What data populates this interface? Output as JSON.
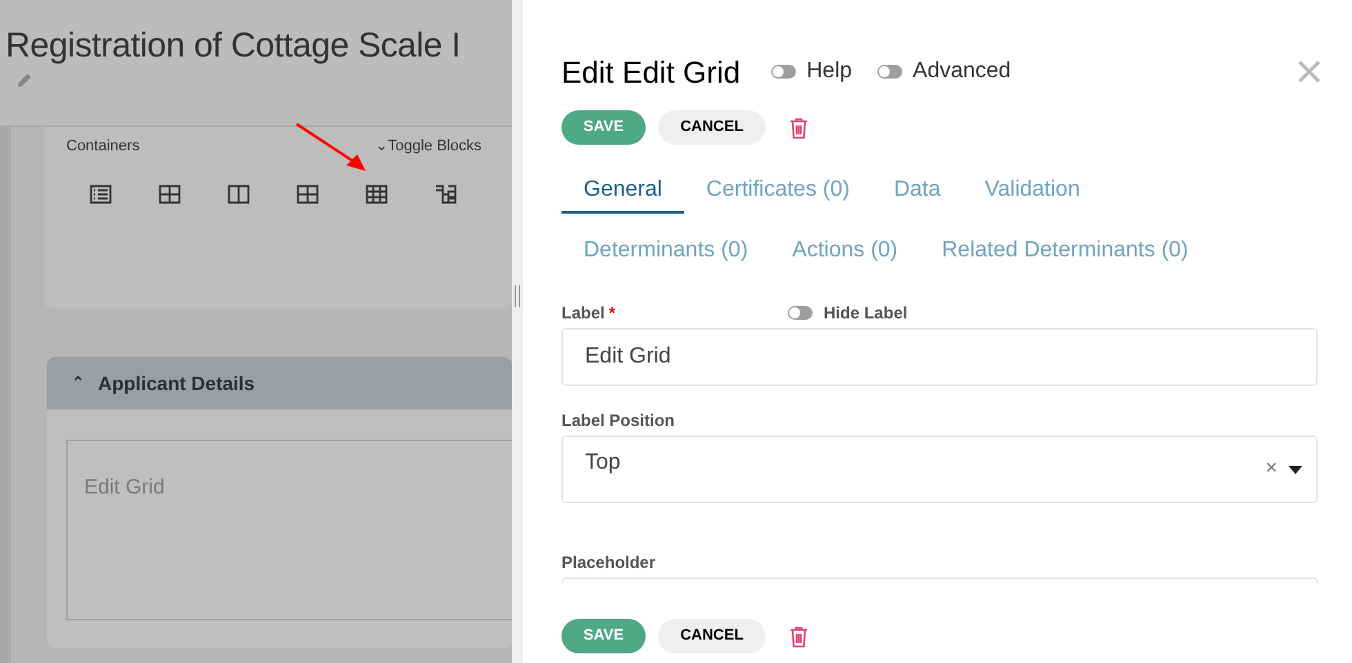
{
  "page": {
    "title": "Registration of Cottage Scale I",
    "toolbox": {
      "label": "Containers",
      "toggle_icon": "⌄",
      "toggle": "Toggle Blocks"
    },
    "panel": {
      "title": "Applicant Details",
      "expanded": true,
      "collapse_icon": "⌃",
      "field_label": "Edit Grid"
    }
  },
  "editor": {
    "title": "Edit Edit Grid",
    "toggles": [
      {
        "label": "Help",
        "on": false
      },
      {
        "label": "Advanced",
        "on": false
      }
    ],
    "buttons": {
      "save": "SAVE",
      "cancel": "CANCEL"
    },
    "tabs": [
      [
        {
          "label": "General",
          "selected": true
        },
        {
          "label": "Certificates (0)",
          "selected": false
        },
        {
          "label": "Data",
          "selected": false
        },
        {
          "label": "Validation",
          "selected": false
        }
      ],
      [
        {
          "label": "Determinants (0)",
          "selected": false
        },
        {
          "label": "Actions (0)",
          "selected": false
        },
        {
          "label": "Related Determinants (0)",
          "selected": false
        }
      ]
    ],
    "fields": [
      {
        "kind": "text",
        "label": "Label",
        "required_mark": "*",
        "hide_label": {
          "label": "Hide Label",
          "on": false
        },
        "value": "Edit Grid"
      },
      {
        "kind": "select",
        "label": "Label Position",
        "value": "Top",
        "clear": "×"
      },
      {
        "kind": "text",
        "label": "Placeholder"
      }
    ],
    "footer_buttons": {
      "save": "SAVE",
      "cancel": "CANCEL"
    }
  }
}
